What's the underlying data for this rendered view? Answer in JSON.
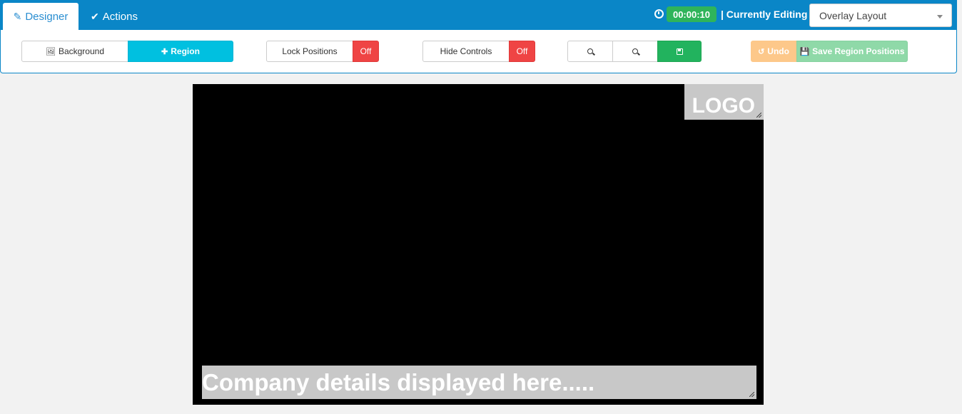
{
  "tabs": [
    {
      "label": "Designer",
      "icon": "edit-icon",
      "active": true
    },
    {
      "label": "Actions",
      "icon": "check-icon",
      "active": false
    }
  ],
  "header": {
    "timer": "00:00:10",
    "editing_label": "| Currently Editing",
    "layout_select": {
      "value": "Overlay Layout"
    }
  },
  "toolbar": {
    "background_label": "Background",
    "region_label": "Region",
    "lock_positions_label": "Lock Positions",
    "lock_positions_state": "Off",
    "hide_controls_label": "Hide Controls",
    "hide_controls_state": "Off",
    "undo_label": "Undo",
    "save_region_positions_label": "Save Region Positions"
  },
  "canvas": {
    "logo_text": "LOGO",
    "company_text": "Company details displayed here....."
  },
  "colors": {
    "header_bg": "#0a86c7",
    "region_btn": "#00c0e0",
    "off_toggle": "#ef4444",
    "save_btn": "#22b35e",
    "undo_btn": "#fdc88a",
    "save_region_btn": "#8fd9a8",
    "timer_badge": "#2fb45a"
  }
}
